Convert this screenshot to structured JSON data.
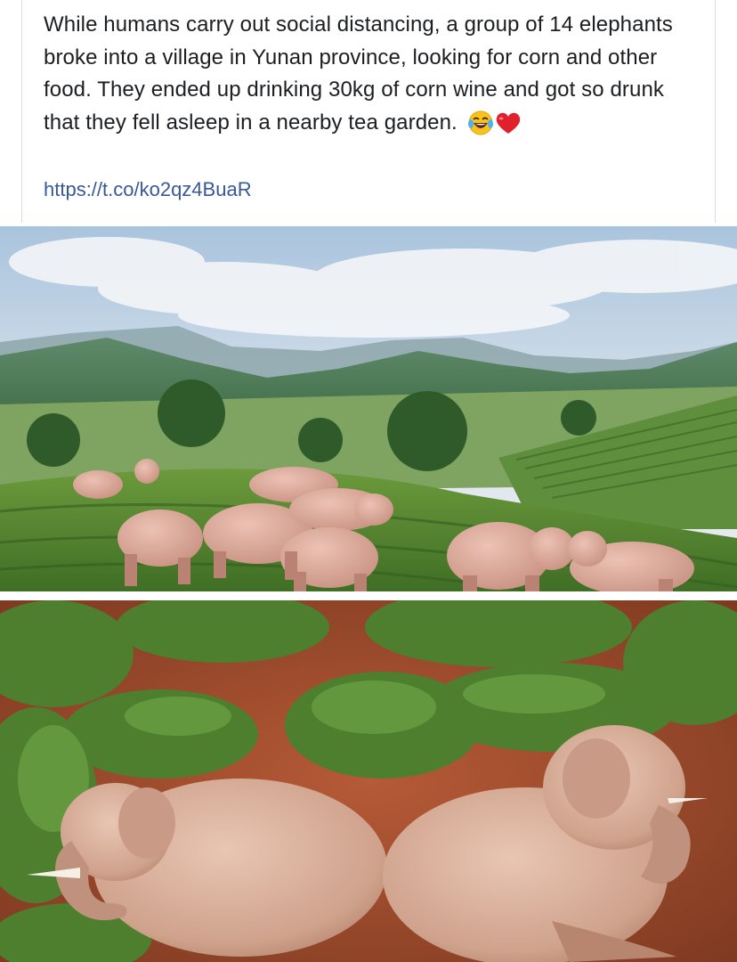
{
  "post": {
    "text": "While humans carry out social distancing, a group of 14 elephants broke into a village in Yunan province, looking for corn and other food. They ended up drinking 30kg of corn wine and got so drunk that they fell asleep in a nearby tea garden.",
    "link": "https://t.co/ko2qz4BuaR",
    "emojis": [
      "laughing-tears-emoji",
      "red-heart-emoji"
    ]
  },
  "photos": [
    {
      "subject": "elephants-standing-in-tea-garden-photo"
    },
    {
      "subject": "elephants-sleeping-in-tea-garden-photo"
    }
  ],
  "colors": {
    "text": "#1c1e21",
    "link": "#385898",
    "elephant": "#d9a99a",
    "tea_green": "#5e8a3a",
    "soil": "#a4492b"
  }
}
